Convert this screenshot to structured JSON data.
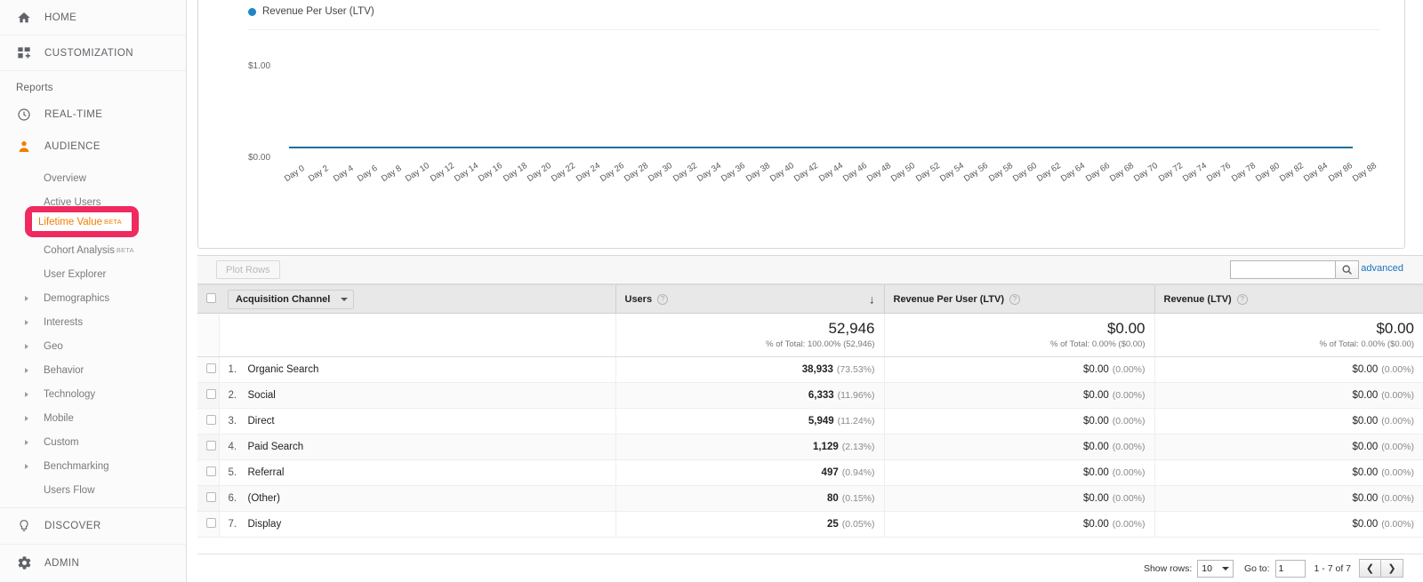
{
  "sidebar": {
    "top_items": [
      {
        "label": "HOME",
        "icon": "home-icon"
      },
      {
        "label": "CUSTOMIZATION",
        "icon": "customization-icon"
      }
    ],
    "reports_label": "Reports",
    "sections": [
      {
        "label": "REAL-TIME",
        "icon": "clock-icon"
      },
      {
        "label": "AUDIENCE",
        "icon": "person-icon"
      }
    ],
    "audience_items": [
      {
        "label": "Overview",
        "expandable": false,
        "beta": ""
      },
      {
        "label": "Active Users",
        "expandable": false,
        "beta": ""
      },
      {
        "label": "Lifetime Value",
        "expandable": false,
        "beta": "BETA",
        "highlighted": true
      },
      {
        "label": "Cohort Analysis",
        "expandable": false,
        "beta": "BETA"
      },
      {
        "label": "User Explorer",
        "expandable": false,
        "beta": ""
      },
      {
        "label": "Demographics",
        "expandable": true,
        "beta": ""
      },
      {
        "label": "Interests",
        "expandable": true,
        "beta": ""
      },
      {
        "label": "Geo",
        "expandable": true,
        "beta": ""
      },
      {
        "label": "Behavior",
        "expandable": true,
        "beta": ""
      },
      {
        "label": "Technology",
        "expandable": true,
        "beta": ""
      },
      {
        "label": "Mobile",
        "expandable": true,
        "beta": ""
      },
      {
        "label": "Custom",
        "expandable": true,
        "beta": ""
      },
      {
        "label": "Benchmarking",
        "expandable": true,
        "beta": ""
      },
      {
        "label": "Users Flow",
        "expandable": false,
        "beta": ""
      }
    ],
    "bottom_items": [
      {
        "label": "DISCOVER",
        "icon": "lightbulb-icon"
      },
      {
        "label": "ADMIN",
        "icon": "gear-icon"
      }
    ],
    "highlight_color": "#ef2a5f",
    "active_color": "#f57c00"
  },
  "chart_data": {
    "type": "line",
    "title": "",
    "legend": [
      {
        "name": "Revenue Per User (LTV)",
        "color": "#1f85c6"
      }
    ],
    "legend_position": "top-left",
    "x": [
      "Day 0",
      "Day 2",
      "Day 4",
      "Day 6",
      "Day 8",
      "Day 10",
      "Day 12",
      "Day 14",
      "Day 16",
      "Day 18",
      "Day 20",
      "Day 22",
      "Day 24",
      "Day 26",
      "Day 28",
      "Day 30",
      "Day 32",
      "Day 34",
      "Day 36",
      "Day 38",
      "Day 40",
      "Day 42",
      "Day 44",
      "Day 46",
      "Day 48",
      "Day 50",
      "Day 52",
      "Day 54",
      "Day 56",
      "Day 58",
      "Day 60",
      "Day 62",
      "Day 64",
      "Day 66",
      "Day 68",
      "Day 70",
      "Day 72",
      "Day 74",
      "Day 76",
      "Day 78",
      "Day 80",
      "Day 82",
      "Day 84",
      "Day 86",
      "Day 88"
    ],
    "series": [
      {
        "name": "Revenue Per User (LTV)",
        "values": [
          0,
          0,
          0,
          0,
          0,
          0,
          0,
          0,
          0,
          0,
          0,
          0,
          0,
          0,
          0,
          0,
          0,
          0,
          0,
          0,
          0,
          0,
          0,
          0,
          0,
          0,
          0,
          0,
          0,
          0,
          0,
          0,
          0,
          0,
          0,
          0,
          0,
          0,
          0,
          0,
          0,
          0,
          0,
          0,
          0
        ]
      }
    ],
    "ylabel": "",
    "xlabel": "",
    "yticks": [
      "$1.00",
      "$0.00"
    ],
    "ylim": [
      0,
      1
    ],
    "grid": false
  },
  "toolbar": {
    "plot_rows_label": "Plot Rows",
    "search_placeholder": "",
    "search_value": "",
    "search_icon": "search-icon",
    "advanced_label": "advanced"
  },
  "table": {
    "dimension_selector": "Acquisition Channel",
    "columns": [
      {
        "label": "Users",
        "help": "?",
        "sorted": true,
        "sort_dir": "desc"
      },
      {
        "label": "Revenue Per User (LTV)",
        "help": "?",
        "sorted": false
      },
      {
        "label": "Revenue (LTV)",
        "help": "?",
        "sorted": false
      }
    ],
    "summary": {
      "users_value": "52,946",
      "users_sub": "% of Total: 100.00% (52,946)",
      "rpu_value": "$0.00",
      "rpu_sub": "% of Total: 0.00% ($0.00)",
      "rev_value": "$0.00",
      "rev_sub": "% of Total: 0.00% ($0.00)"
    },
    "rows": [
      {
        "index": "1.",
        "channel": "Organic Search",
        "users": "38,933",
        "users_pct": "(73.53%)",
        "rpu": "$0.00",
        "rpu_pct": "(0.00%)",
        "rev": "$0.00",
        "rev_pct": "(0.00%)"
      },
      {
        "index": "2.",
        "channel": "Social",
        "users": "6,333",
        "users_pct": "(11.96%)",
        "rpu": "$0.00",
        "rpu_pct": "(0.00%)",
        "rev": "$0.00",
        "rev_pct": "(0.00%)"
      },
      {
        "index": "3.",
        "channel": "Direct",
        "users": "5,949",
        "users_pct": "(11.24%)",
        "rpu": "$0.00",
        "rpu_pct": "(0.00%)",
        "rev": "$0.00",
        "rev_pct": "(0.00%)"
      },
      {
        "index": "4.",
        "channel": "Paid Search",
        "users": "1,129",
        "users_pct": "(2.13%)",
        "rpu": "$0.00",
        "rpu_pct": "(0.00%)",
        "rev": "$0.00",
        "rev_pct": "(0.00%)"
      },
      {
        "index": "5.",
        "channel": "Referral",
        "users": "497",
        "users_pct": "(0.94%)",
        "rpu": "$0.00",
        "rpu_pct": "(0.00%)",
        "rev": "$0.00",
        "rev_pct": "(0.00%)"
      },
      {
        "index": "6.",
        "channel": "(Other)",
        "users": "80",
        "users_pct": "(0.15%)",
        "rpu": "$0.00",
        "rpu_pct": "(0.00%)",
        "rev": "$0.00",
        "rev_pct": "(0.00%)"
      },
      {
        "index": "7.",
        "channel": "Display",
        "users": "25",
        "users_pct": "(0.05%)",
        "rpu": "$0.00",
        "rpu_pct": "(0.00%)",
        "rev": "$0.00",
        "rev_pct": "(0.00%)"
      }
    ]
  },
  "pagination": {
    "show_rows_label": "Show rows:",
    "rows_value": "10",
    "goto_label": "Go to:",
    "goto_value": "1",
    "range_text": "1 - 7 of 7",
    "prev_icon": "chevron-left-icon",
    "next_icon": "chevron-right-icon"
  }
}
